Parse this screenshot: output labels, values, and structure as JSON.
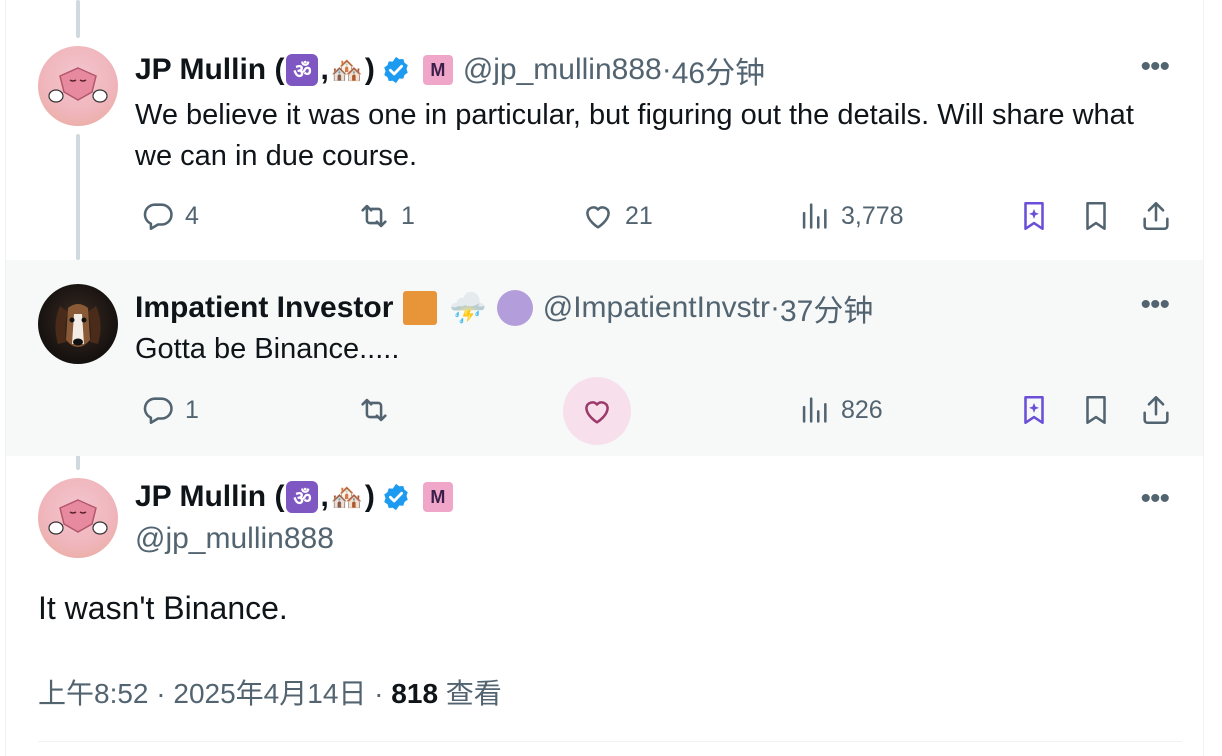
{
  "tweets": [
    {
      "name": "JP Mullin (",
      "emoji1": "ॐ",
      "comma": ",",
      "emoji2": "🏘️",
      "close": ")",
      "m_badge": "M",
      "handle": "@jp_mullin888",
      "dot": " · ",
      "time": "46分钟",
      "text": "We believe it was one in particular, but figuring out the details. Will share what we can in due course.",
      "replies": "4",
      "reposts": "1",
      "likes": "21",
      "views": "3,778"
    },
    {
      "name": "Impatient Investor",
      "storm": "⛈️",
      "handle": "@ImpatientInvstr",
      "dot": " · ",
      "time": "37分钟",
      "text": "Gotta be Binance.....",
      "replies": "1",
      "views": "826"
    }
  ],
  "main": {
    "name": "JP Mullin (",
    "emoji1": "ॐ",
    "comma": ",",
    "emoji2": "🏘️",
    "close": ")",
    "m_badge": "M",
    "handle": "@jp_mullin888",
    "text": "It wasn't Binance.",
    "time": "上午8:52",
    "date": "2025年4月14日",
    "views_count": "818",
    "views_label": "查看"
  },
  "icons": {
    "more": "more-icon",
    "reply": "reply-icon",
    "repost": "repost-icon",
    "like": "like-icon",
    "views": "views-icon",
    "grok_bookmark": "grok-bookmark-icon",
    "bookmark": "bookmark-icon",
    "share": "share-icon"
  },
  "colors": {
    "accent": "#1d9bf0",
    "muted": "#536471",
    "grok": "#6b4fd8",
    "like_hover": "#f91880"
  }
}
